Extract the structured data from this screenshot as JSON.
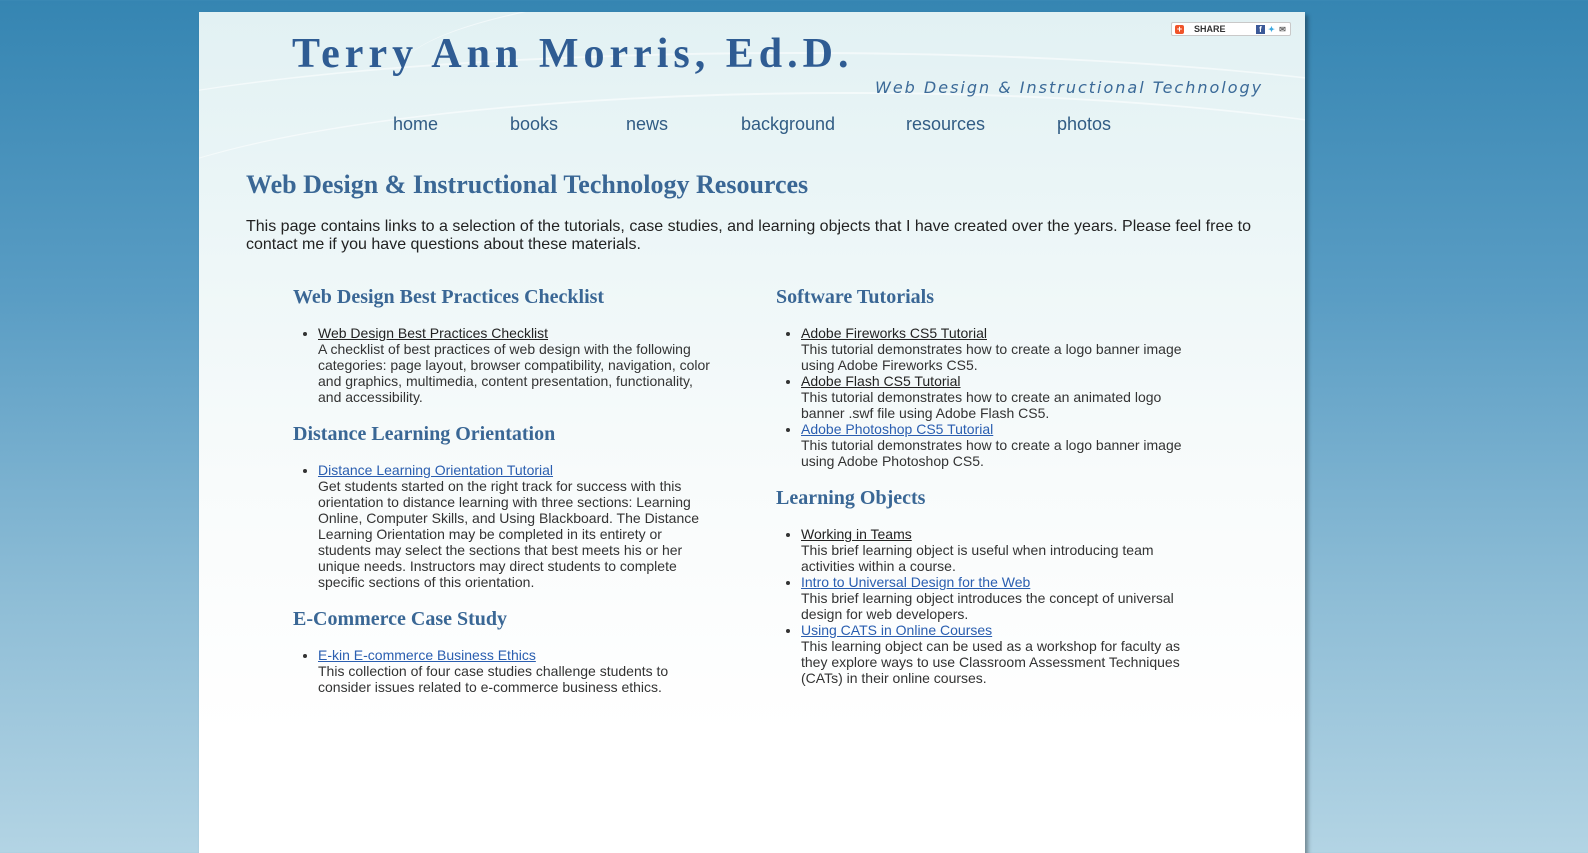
{
  "header": {
    "title": "Terry Ann Morris, Ed.D.",
    "tagline": "Web Design & Instructional Technology",
    "share_label": "SHARE"
  },
  "nav": [
    "home",
    "books",
    "news",
    "background",
    "resources",
    "photos"
  ],
  "main": {
    "heading": "Web Design & Instructional Technology Resources",
    "intro": "This page contains links to a selection of the tutorials, case studies, and learning objects that I have created over the years. Please feel free to contact me if you have questions about these materials."
  },
  "left_column": [
    {
      "heading": "Web Design Best Practices Checklist",
      "items": [
        {
          "link": "Web Design Best Practices Checklist",
          "description": "A checklist of best practices of web design with the following categories: page layout, browser compatibility, navigation, color and graphics, multimedia, content presentation, functionality, and accessibility."
        }
      ]
    },
    {
      "heading": "Distance Learning Orientation",
      "items": [
        {
          "link": "Distance Learning Orientation Tutorial",
          "description": "Get students started on the right track for success with this orientation to distance learning with three sections: Learning Online, Computer Skills, and Using Blackboard. The Distance Learning Orientation may be completed in its entirety or students may select the sections that best meets his or her unique needs. Instructors may direct students to complete specific sections of this orientation."
        }
      ]
    },
    {
      "heading": "E-Commerce Case Study",
      "items": [
        {
          "link": "E-kin E-commerce Business Ethics",
          "description": "This collection of four case studies challenge students to consider issues related to e-commerce business ethics."
        }
      ]
    }
  ],
  "right_column": [
    {
      "heading": "Software Tutorials",
      "items": [
        {
          "link": "Adobe Fireworks CS5 Tutorial",
          "description": "This tutorial demonstrates how to create a logo banner image using Adobe Fireworks CS5."
        },
        {
          "link": "Adobe Flash CS5 Tutorial",
          "description": "This tutorial demonstrates how to create an animated logo banner .swf file using Adobe Flash CS5."
        },
        {
          "link": "Adobe Photoshop CS5 Tutorial",
          "description": "This tutorial demonstrates how to create a logo banner image using Adobe Photoshop CS5."
        }
      ]
    },
    {
      "heading": "Learning Objects",
      "items": [
        {
          "link": "Working in Teams",
          "description": "This brief learning object is useful when introducing team activities within a course."
        },
        {
          "link": "Intro to Universal Design for the Web",
          "description": "This brief learning object introduces the concept of universal design for web developers."
        },
        {
          "link": "Using CATS in Online Courses",
          "description": "This learning object can be used as a workshop for faculty as they explore ways to use Classroom Assessment Techniques (CATs) in their online courses."
        }
      ]
    }
  ]
}
